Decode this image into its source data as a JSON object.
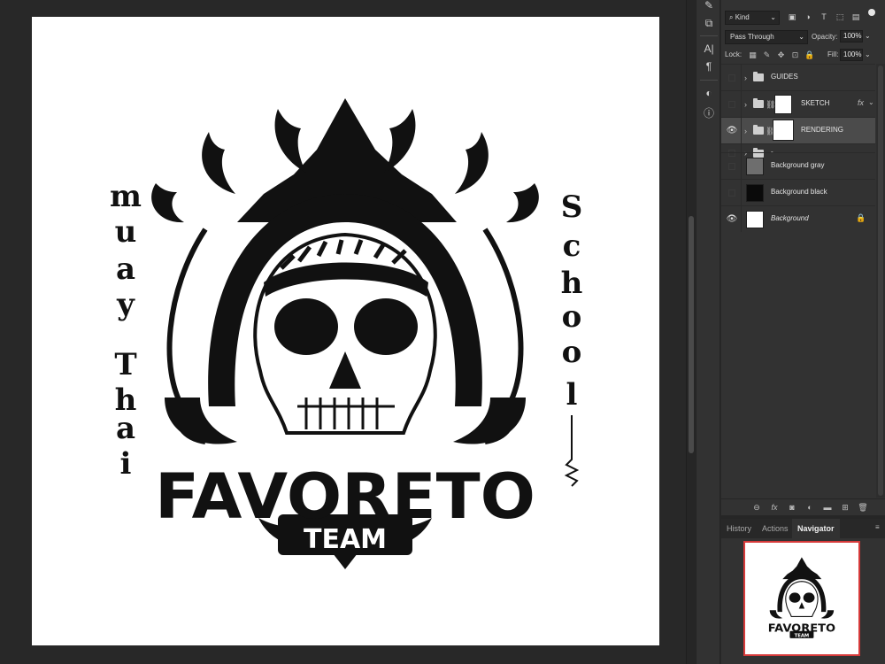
{
  "artwork": {
    "left_text_letters": [
      "m",
      "u",
      "a",
      "y",
      "T",
      "h",
      "a",
      "i"
    ],
    "right_text_letters": [
      "S",
      "c",
      "h",
      "o",
      "o",
      "l"
    ],
    "main_title": "FAVORETO",
    "sub_title": "TEAM"
  },
  "layers_panel": {
    "kind_filter": "Kind",
    "blend_mode": "Pass Through",
    "opacity_label": "Opacity:",
    "opacity_value": "100%",
    "lock_label": "Lock:",
    "fill_label": "Fill:",
    "fill_value": "100%",
    "layers": [
      {
        "name": "GUIDES",
        "visible": false,
        "type": "group"
      },
      {
        "name": "SKETCH",
        "visible": false,
        "type": "group-mask",
        "fx": "fx"
      },
      {
        "name": "RENDERING",
        "visible": true,
        "type": "group-mask",
        "selected": true
      },
      {
        "name": "-",
        "visible": false,
        "type": "group"
      },
      {
        "name": "Background gray",
        "visible": false,
        "type": "layer",
        "swatch": "#6e6e6e"
      },
      {
        "name": "Background black",
        "visible": false,
        "type": "layer",
        "swatch": "#0a0a0a"
      },
      {
        "name": "Background",
        "visible": true,
        "type": "background",
        "swatch": "#ffffff",
        "locked": true
      }
    ]
  },
  "bottom_panel": {
    "tabs": [
      "History",
      "Actions",
      "Navigator"
    ],
    "active_tab": "Navigator"
  },
  "colors": {
    "canvas": "#ffffff",
    "workspace": "#282828",
    "panel": "#323232",
    "selected_layer": "#4b4b4b",
    "navigator_frame": "#d63a3a"
  }
}
